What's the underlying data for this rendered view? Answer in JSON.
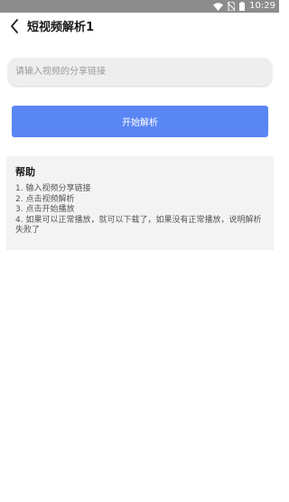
{
  "status_bar": {
    "time": "10:29",
    "icons": [
      "wifi-icon",
      "no-sim-icon",
      "battery-icon"
    ]
  },
  "app_bar": {
    "title": "短视频解析1",
    "back_icon": "back-arrow-icon"
  },
  "link_input": {
    "value": "",
    "placeholder": "请输入视频的分享链接"
  },
  "parse_button": {
    "label": "开始解析"
  },
  "help": {
    "title": "帮助",
    "items": [
      "1. 输入视频分享链接",
      "2. 点击视频解析",
      "3. 点击开始播放",
      "4. 如果可以正常播放，就可以下载了，如果没有正常播放，说明解析失败了"
    ]
  },
  "colors": {
    "status_bar": "#8c8c8c",
    "accent_button": "#5a86f4",
    "input_bg": "#eeeeee",
    "help_bg": "#f3f3f3"
  }
}
